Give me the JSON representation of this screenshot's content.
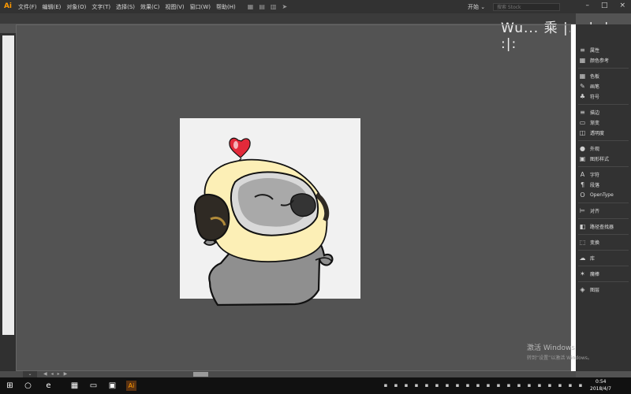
{
  "app": {
    "logo_text": "Ai",
    "menu": [
      "文件(F)",
      "编辑(E)",
      "对象(O)",
      "文字(T)",
      "选择(S)",
      "效果(C)",
      "视图(V)",
      "窗口(W)",
      "帮助(H)"
    ],
    "toolbar_icons": [
      "bridge-icon",
      "stock-icon",
      "arrange-icon",
      "send-icon"
    ],
    "workspace": "开始 ⌄",
    "search_placeholder": "搜索 Stock",
    "window_controls": [
      "–",
      "□",
      "×"
    ]
  },
  "watermark": "Wu... 乘 |... |, |... :|:",
  "right_panel": [
    {
      "icon": "properties-icon",
      "glyph": "≡",
      "label": "属性"
    },
    {
      "icon": "color-guide-icon",
      "glyph": "▦",
      "label": "颜色参考"
    },
    {
      "icon": "swatches-icon",
      "glyph": "▦",
      "label": "色板"
    },
    {
      "icon": "brushes-icon",
      "glyph": "✎",
      "label": "画笔"
    },
    {
      "icon": "symbols-icon",
      "glyph": "♣",
      "label": "符号"
    },
    {
      "icon": "stroke-icon",
      "glyph": "≡",
      "label": "描边"
    },
    {
      "icon": "gradient-icon",
      "glyph": "▭",
      "label": "渐变"
    },
    {
      "icon": "transparency-icon",
      "glyph": "◫",
      "label": "透明度"
    },
    {
      "icon": "appearance-icon",
      "glyph": "●",
      "label": "外观"
    },
    {
      "icon": "graphic-styles-icon",
      "glyph": "▣",
      "label": "图形样式"
    },
    {
      "icon": "character-icon",
      "glyph": "A",
      "label": "字符"
    },
    {
      "icon": "paragraph-icon",
      "glyph": "¶",
      "label": "段落"
    },
    {
      "icon": "opentype-icon",
      "glyph": "O",
      "label": "OpenType"
    },
    {
      "icon": "align-icon",
      "glyph": "⊨",
      "label": "对齐"
    },
    {
      "icon": "pathfinder-icon",
      "glyph": "◧",
      "label": "路径查找器"
    },
    {
      "icon": "transform-icon",
      "glyph": "⬚",
      "label": "变换"
    },
    {
      "icon": "libraries-icon",
      "glyph": "☁",
      "label": "库"
    },
    {
      "icon": "magic-wand-icon",
      "glyph": "✶",
      "label": "魔棒"
    },
    {
      "icon": "layers-icon",
      "glyph": "◈",
      "label": "图层"
    }
  ],
  "status": {
    "zoom_arrows": "⌄",
    "artboard_nav": [
      "◀",
      "◂",
      "▸",
      "▶"
    ]
  },
  "activation": {
    "title": "激活 Windows",
    "subtitle": "转到“设置”以激活 Windows。"
  },
  "taskbar": {
    "time": "0:54",
    "date": "2018/4/7"
  },
  "colors": {
    "workspace_bg": "#535353",
    "artboard": "#f1f1f1",
    "heart_red": "#e22a3a",
    "hood_yellow": "#fcefb6",
    "body_grey": "#8f8f8f"
  }
}
